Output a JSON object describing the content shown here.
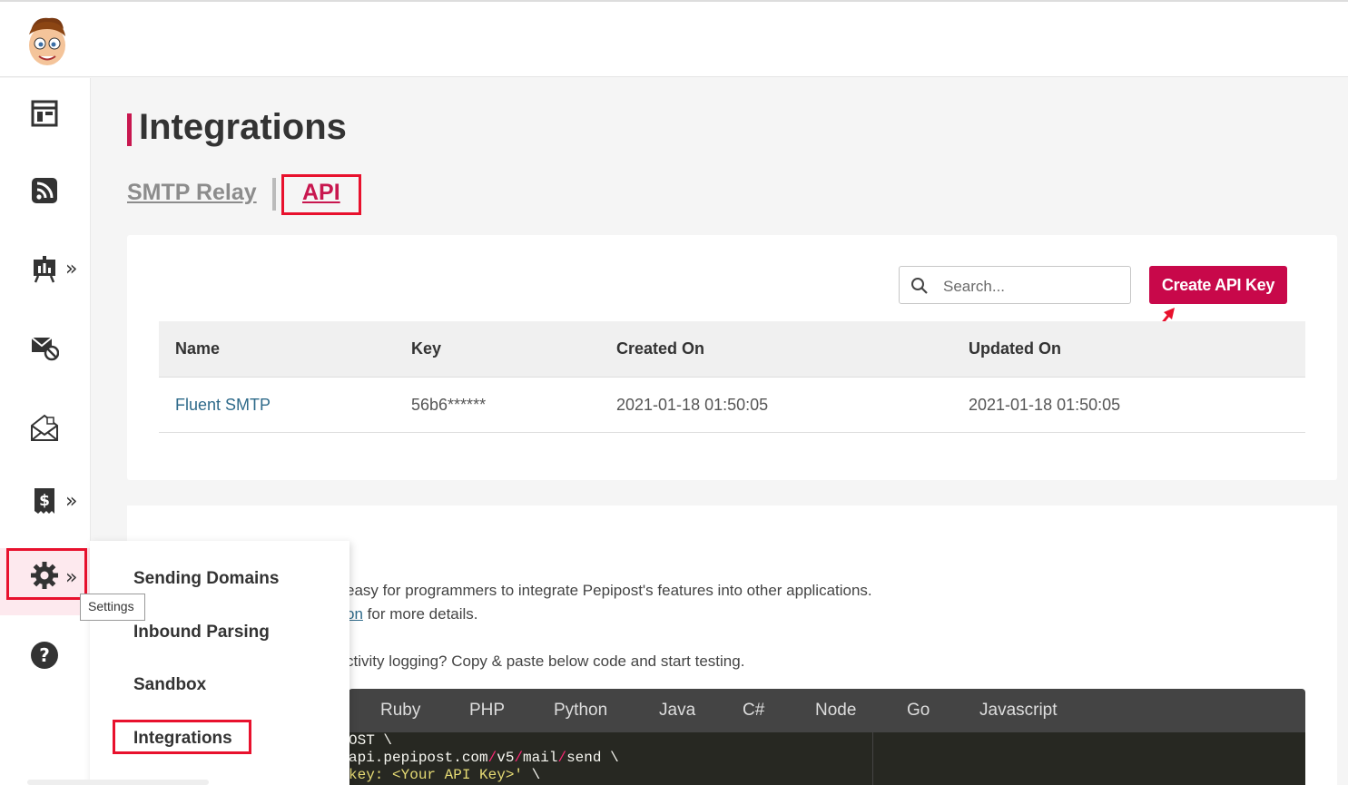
{
  "page_title": "Integrations",
  "tabs": {
    "smtp_label": "SMTP Relay",
    "api_label": "API"
  },
  "search": {
    "placeholder": "Search..."
  },
  "create_button_label": "Create API Key",
  "table": {
    "headers": [
      "Name",
      "Key",
      "Created On",
      "Updated On"
    ],
    "rows": [
      {
        "name": "Fluent SMTP",
        "key": "56b6******",
        "created": "2021-01-18 01:50:05",
        "updated": "2021-01-18 01:50:05"
      }
    ]
  },
  "sidebar": {
    "icons": [
      "dashboard-icon",
      "rss-icon",
      "reports-icon",
      "suppression-icon",
      "templates-icon",
      "billing-icon",
      "settings-icon",
      "help-icon"
    ],
    "chevron": "»",
    "tooltip": "Settings"
  },
  "settings_menu": {
    "items": [
      "Sending Domains",
      "Inbound Parsing",
      "Sandbox",
      "Integrations"
    ]
  },
  "description": {
    "line1": "easy for programmers to integrate Pepipost's features into other applications.",
    "line2_link": "on",
    "line2_rest": " for more details.",
    "line3": "ctivity logging? Copy & paste below code and start testing."
  },
  "code_tabs": [
    "Ruby",
    "PHP",
    "Python",
    "Java",
    "C#",
    "Node",
    "Go",
    "Javascript"
  ],
  "code": {
    "line1": "OST \\",
    "line2_a": "api.pepipost.com",
    "line2_s1": "/",
    "line2_b": "v5",
    "line2_s2": "/",
    "line2_c": "mail",
    "line2_s3": "/",
    "line2_d": "send \\",
    "line3_a": "key: <Your API Key>'",
    "line3_b": " \\"
  },
  "colors": {
    "brand": "#c8084a",
    "highlight_box": "#e8112d",
    "link": "#2e6a8a"
  }
}
